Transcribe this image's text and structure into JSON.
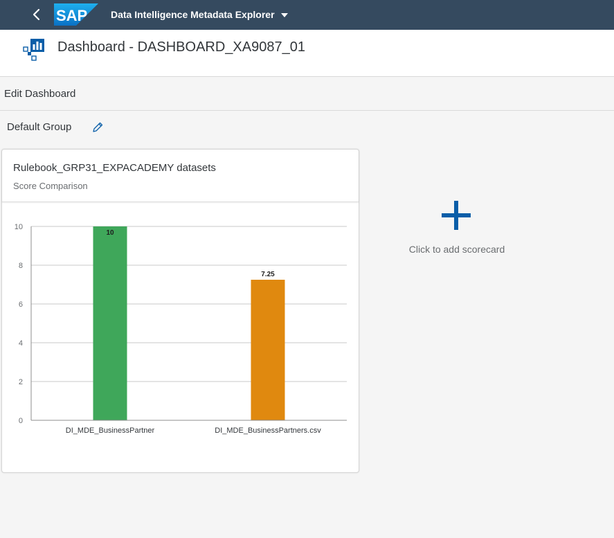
{
  "shellbar": {
    "logo_text": "SAP",
    "app_title": "Data Intelligence Metadata Explorer"
  },
  "header": {
    "title": "Dashboard - DASHBOARD_XA9087_01"
  },
  "toolbar": {
    "edit_label": "Edit Dashboard"
  },
  "group": {
    "name": "Default Group"
  },
  "card": {
    "title": "Rulebook_GRP31_EXPACADEMY datasets",
    "subtitle": "Score Comparison"
  },
  "chart_data": {
    "type": "bar",
    "categories": [
      "DI_MDE_BusinessPartner",
      "DI_MDE_BusinessPartners.csv"
    ],
    "values": [
      10,
      7.25
    ],
    "data_labels": [
      "10",
      "7.25"
    ],
    "colors": [
      "#3fa75a",
      "#e0890f"
    ],
    "ylim": [
      0,
      10
    ],
    "yticks": [
      0,
      2,
      4,
      6,
      8,
      10
    ],
    "grid": true
  },
  "add_scorecard": {
    "label": "Click to add scorecard"
  },
  "colors": {
    "shell_background": "#354a5f",
    "accent": "#0a5ea8",
    "grid": "#c8c8c8"
  }
}
